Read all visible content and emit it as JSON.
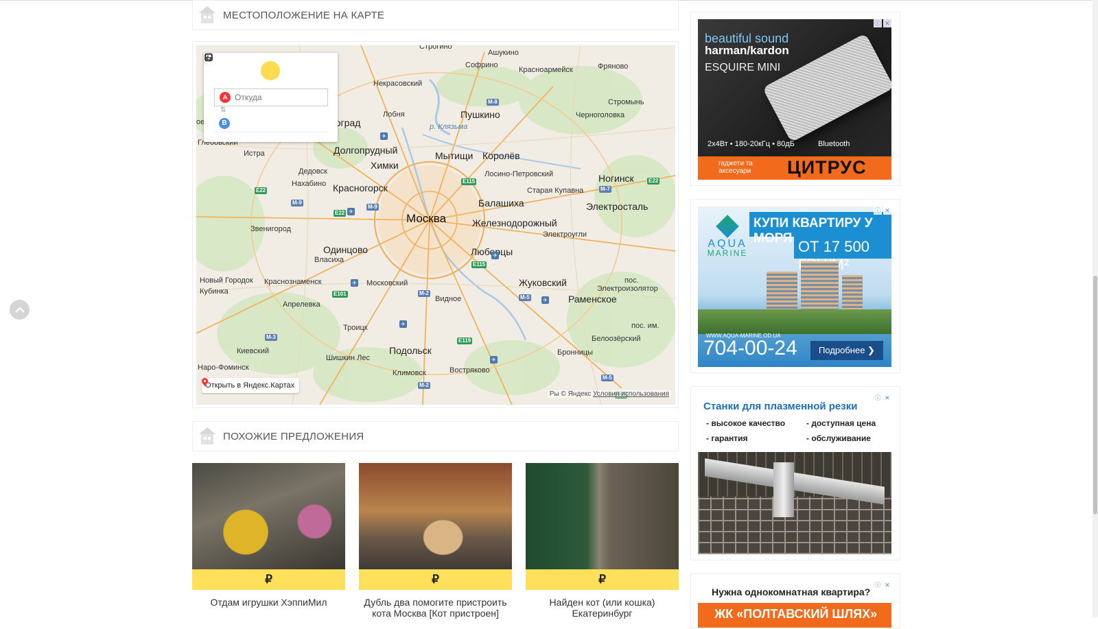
{
  "sections": {
    "map_title": "МЕСТОПОЛОЖЕНИЕ НА КАРТЕ",
    "similar_title": "ПОХОЖИЕ ПРЕДЛОЖЕНИЯ"
  },
  "route_panel": {
    "modes": [
      "car-icon",
      "bus-icon",
      "pedestrian-icon"
    ],
    "active_mode": "bus",
    "point_a_letter": "A",
    "point_a_placeholder": "Откуда",
    "point_b_letter": "B",
    "point_b_value": ""
  },
  "map": {
    "open_link": "Открыть в Яндекс.Картах",
    "copyright_prefix": "Ры © Яндекс",
    "terms_link": "Условия использования",
    "labels": [
      {
        "text": "Ашукино",
        "cls": ""
      },
      {
        "text": "Софрино",
        "cls": ""
      },
      {
        "text": "Красноармейск",
        "cls": ""
      },
      {
        "text": "Фряново",
        "cls": ""
      },
      {
        "text": "Некрасовский",
        "cls": ""
      },
      {
        "text": "Строгино",
        "cls": ""
      },
      {
        "text": "Стромынь",
        "cls": ""
      },
      {
        "text": "Лобня",
        "cls": ""
      },
      {
        "text": "Пушкино",
        "cls": "city"
      },
      {
        "text": "Черноголовка",
        "cls": ""
      },
      {
        "text": "ноград",
        "cls": "city"
      },
      {
        "text": "р. Клязьма",
        "cls": "river"
      },
      {
        "text": "Глебовский",
        "cls": ""
      },
      {
        "text": "Долгопрудный",
        "cls": "city"
      },
      {
        "text": "Истра",
        "cls": ""
      },
      {
        "text": "Химки",
        "cls": "city"
      },
      {
        "text": "Мытищи",
        "cls": "city"
      },
      {
        "text": "Королёв",
        "cls": "city"
      },
      {
        "text": "Дедовск",
        "cls": ""
      },
      {
        "text": "Лосино-Петровский",
        "cls": ""
      },
      {
        "text": "Ногинск",
        "cls": "city"
      },
      {
        "text": "Нахабино",
        "cls": ""
      },
      {
        "text": "Красногорск",
        "cls": "city"
      },
      {
        "text": "Старая Купавна",
        "cls": ""
      },
      {
        "text": "Балашиха",
        "cls": "city"
      },
      {
        "text": "Электросталь",
        "cls": "city"
      },
      {
        "text": "Звенигород",
        "cls": ""
      },
      {
        "text": "Москва",
        "cls": "capital"
      },
      {
        "text": "Железнодорожный",
        "cls": "city"
      },
      {
        "text": "Электроугли",
        "cls": ""
      },
      {
        "text": "Одинцово",
        "cls": "city"
      },
      {
        "text": "Власиха",
        "cls": ""
      },
      {
        "text": "Люберцы",
        "cls": "city"
      },
      {
        "text": "Новый Городок",
        "cls": ""
      },
      {
        "text": "Краснознаменск",
        "cls": ""
      },
      {
        "text": "Московский",
        "cls": ""
      },
      {
        "text": "Жуковский",
        "cls": "city"
      },
      {
        "text": "пос.",
        "cls": ""
      },
      {
        "text": "Кубинка",
        "cls": ""
      },
      {
        "text": "Электроизолятор",
        "cls": ""
      },
      {
        "text": "Апрелевка",
        "cls": ""
      },
      {
        "text": "Видное",
        "cls": ""
      },
      {
        "text": "Раменское",
        "cls": "city"
      },
      {
        "text": "Троицк",
        "cls": ""
      },
      {
        "text": "пос. им.",
        "cls": ""
      },
      {
        "text": "Белоозёрский",
        "cls": ""
      },
      {
        "text": "Киевский",
        "cls": ""
      },
      {
        "text": "Подольск",
        "cls": "city"
      },
      {
        "text": "Бронницы",
        "cls": ""
      },
      {
        "text": "Шишкин Лес",
        "cls": ""
      },
      {
        "text": "Наро-Фоминск",
        "cls": ""
      },
      {
        "text": "Климовск",
        "cls": ""
      },
      {
        "text": "Вострякoво",
        "cls": ""
      },
      {
        "text": "ое",
        "cls": ""
      }
    ],
    "shields": [
      {
        "text": "E22",
        "cls": "e"
      },
      {
        "text": "M-9",
        "cls": "m"
      },
      {
        "text": "E22",
        "cls": "e"
      },
      {
        "text": "M-9",
        "cls": "m"
      },
      {
        "text": "E115",
        "cls": "e"
      },
      {
        "text": "M-8",
        "cls": "m"
      },
      {
        "text": "M-7",
        "cls": "m"
      },
      {
        "text": "E22",
        "cls": "e"
      },
      {
        "text": "E115",
        "cls": "e"
      },
      {
        "text": "E101",
        "cls": "e"
      },
      {
        "text": "M-2",
        "cls": "m"
      },
      {
        "text": "M-5",
        "cls": "m"
      },
      {
        "text": "M-3",
        "cls": "m"
      },
      {
        "text": "E119",
        "cls": "e"
      },
      {
        "text": "M-2",
        "cls": "m"
      },
      {
        "text": "M-5",
        "cls": "m"
      },
      {
        "text": "E30",
        "cls": "e"
      }
    ]
  },
  "offers": [
    {
      "price": "₽",
      "title_line1": "Отдам игрушки ХэппиМил",
      "title_line2": ""
    },
    {
      "price": "₽",
      "title_line1": "Дубль два помогите пристроить",
      "title_line2": "кота Москва [Кот пристроен]"
    },
    {
      "price": "₽",
      "title_line1": "Найден кот (или кошка)",
      "title_line2": "Екатеринбург"
    }
  ],
  "ads": {
    "info_icon": "ⓘ",
    "close_icon": "✕",
    "harman": {
      "line1": "beautiful sound",
      "line2": "harman/kardon",
      "line3": "ESQUIRE MINI",
      "spec": "2x4Вт • 180-20кГц • 80дБ",
      "bluetooth": "Bluetooth",
      "footer_small": "гаджети та аксесуари",
      "footer_brand": "ЦИТРУС"
    },
    "aqua": {
      "headline": "КУПИ КВАРТИРУ У МОРЯ",
      "price": "ОТ 17 500 ГРН/М²",
      "logo_top": "AQUA",
      "logo_bottom": "MARINE",
      "site": "WWW.AQUA-MARINE.OD.UA",
      "phone": "704-00-24",
      "button": "Подробнее ❯"
    },
    "plasma": {
      "headline": "Станки для плазменной резки",
      "f1": "- высокое качество",
      "f2": "- доступная цена",
      "f3": "- гарантия",
      "f4": "- обслуживание"
    },
    "poltava": {
      "question": "Нужна однокомнатная квартира?",
      "bar": "ЖК «ПОЛТАВСКИЙ ШЛЯХ»"
    }
  },
  "colors": {
    "yellow": "#ffe05a",
    "orange": "#f26a1b",
    "blue": "#1c8ed2"
  }
}
